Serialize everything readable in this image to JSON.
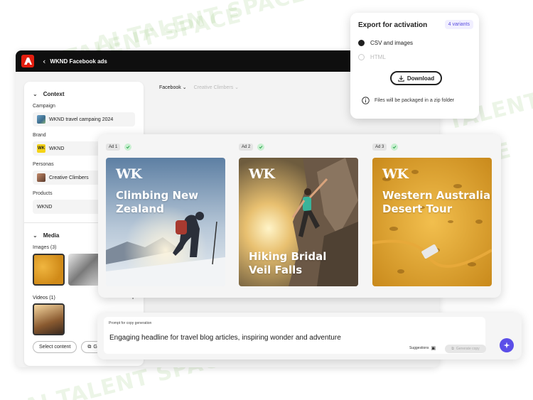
{
  "watermark": "AI TALENT SPACE",
  "app": {
    "title": "WKND Facebook ads",
    "back_icon": "chevron-left-icon",
    "logo_icon": "adobe-logo"
  },
  "context": {
    "heading": "Context",
    "campaign_label": "Campaign",
    "campaign_value": "WKND travel campaing 2024",
    "brand_label": "Brand",
    "brand_value": "WKND",
    "brand_badge": "WK",
    "personas_label": "Personas",
    "personas_value": "Creative Climbers",
    "products_label": "Products",
    "products_value": "WKND"
  },
  "media": {
    "heading": "Media",
    "images_label": "Images (3)",
    "videos_label": "Videos (1)",
    "add_label": "+",
    "select_content": "Select content",
    "generate_partial": "Ge"
  },
  "channels": {
    "channel": "Facebook",
    "persona_filter": "Creative Climbers"
  },
  "ads": [
    {
      "tag": "Ad 1",
      "logo": "WK",
      "title_line1": "Climbing New",
      "title_line2": "Zealand"
    },
    {
      "tag": "Ad 2",
      "logo": "WK",
      "title_line1": "Hiking Bridal",
      "title_line2": "Veil Falls"
    },
    {
      "tag": "Ad 3",
      "logo": "WK",
      "title_line1": "Western Australia",
      "title_line2": "Desert Tour"
    }
  ],
  "export": {
    "title": "Export for activation",
    "variants": "4 variants",
    "option_csv": "CSV and images",
    "option_html": "HTML",
    "download": "Download",
    "note": "Files will be packaged in a zip folder"
  },
  "prompt": {
    "label": "Prompt for copy generation",
    "text": "Engaging headline for travel blog articles, inspiring wonder and adventure",
    "suggestions": "Suggestions",
    "generate": "Generate copy"
  },
  "colors": {
    "accent": "#5b4ee8",
    "adobe_red": "#e31e0f",
    "success": "#2fa84f"
  }
}
